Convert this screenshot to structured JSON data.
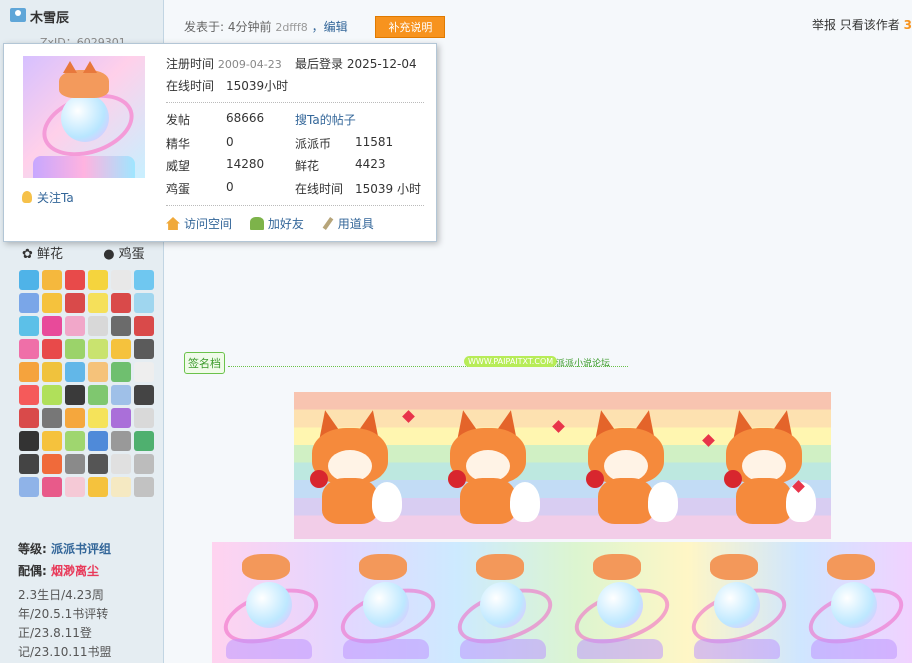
{
  "user": {
    "name": "木雪辰",
    "zxid": "ZxID：6029301"
  },
  "post": {
    "posted_prefix": "发表于: ",
    "time": "4分钟前",
    "hash": "2dfff8",
    "edit": "，编辑",
    "supplement": "补充说明"
  },
  "right_actions": {
    "report": "举报",
    "only_author": "只看该作者",
    "floor": "3"
  },
  "popup": {
    "reg_label": "注册时间",
    "reg_value": "2009-04-23",
    "last_label": "最后登录",
    "last_value": "2025-12-04",
    "online_label": "在线时间",
    "online_value": "15039小时",
    "stats": [
      {
        "label": "发帖",
        "value": "68666"
      },
      {
        "label": "精华",
        "value": "0"
      },
      {
        "label": "威望",
        "value": "14280"
      },
      {
        "label": "鸡蛋",
        "value": "0"
      }
    ],
    "stats2": [
      {
        "label": "搜Ta的帖子",
        "value": ""
      },
      {
        "label": "派派币",
        "value": "11581"
      },
      {
        "label": "鲜花",
        "value": "4423"
      },
      {
        "label": "在线时间",
        "value": "15039 小时"
      }
    ],
    "follow": "关注Ta",
    "actions": [
      "访问空间",
      "加好友",
      "用道具"
    ]
  },
  "sidebar": {
    "flower": "鲜花",
    "egg": "鸡蛋",
    "level_label": "等级: ",
    "level_value": "派派书评组",
    "pair_label": "配偶: ",
    "pair_value": "烟渺离尘",
    "notes": "2.3生日/4.23周年/20.5.1书评转正/23.8.11登记/23.10.11书盟"
  },
  "signature": {
    "label": "签名档",
    "site": "WWW.PAIPAITXT.COM",
    "forum": "派派小说论坛"
  },
  "colors": {
    "accent": "#f7931e",
    "link": "#336699",
    "sidebar_bg": "#e5edf2",
    "spouse": "#e83a5a"
  },
  "badge_colors": [
    "#4fb3e8",
    "#f5b83d",
    "#e84a4a",
    "#f5d43d",
    "#e8e8e8",
    "#6fc7f0",
    "#7aa6e8",
    "#f5c23d",
    "#d94a4a",
    "#f5e05a",
    "#d94a4a",
    "#9fd6ef",
    "#5cc0e8",
    "#e84a9a",
    "#f1a7c9",
    "#d8d8d8",
    "#6b6b6b",
    "#d94a4a",
    "#ef6fa8",
    "#e84a4a",
    "#9bd36a",
    "#c9e36f",
    "#f5c23d",
    "#5b5b5b",
    "#f5a33d",
    "#f0c23d",
    "#62b7e8",
    "#f5c27a",
    "#6fbf6f",
    "#eeeeee",
    "#f55a5a",
    "#b0e05a",
    "#3a3a3a",
    "#7fc76f",
    "#9fc0e8",
    "#444444",
    "#d94a4a",
    "#777777",
    "#f5a73d",
    "#f5e35a",
    "#aa6fd9",
    "#d9d9d9",
    "#333333",
    "#f5c23d",
    "#9fd66f",
    "#4f8ad9",
    "#999999",
    "#4fb06f",
    "#444444",
    "#f06a3a",
    "#8a8a8a",
    "#555555",
    "#e0e0e0",
    "#bcbcbc",
    "#8fb3e8",
    "#e85a8a",
    "#f5c9d6",
    "#f5c23d",
    "#f5e9c2",
    "#c2c2c2"
  ]
}
